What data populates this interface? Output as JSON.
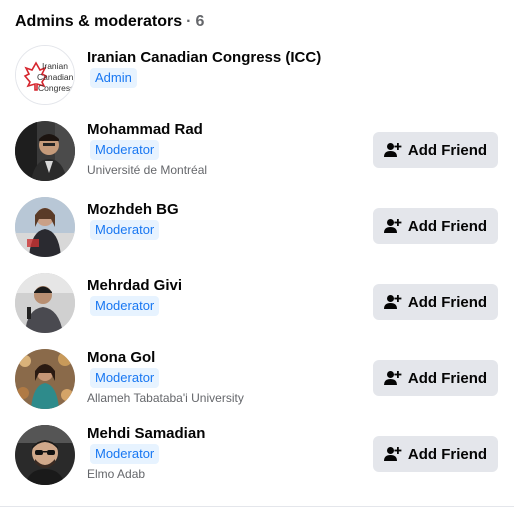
{
  "header": {
    "title": "Admins & moderators",
    "separator": "·",
    "count": "6"
  },
  "members": [
    {
      "name": "Iranian Canadian Congress (ICC)",
      "role": "Admin",
      "subtitle": "",
      "logo_text": [
        "Iranian",
        "Canadian",
        "Congress"
      ]
    },
    {
      "name": "Mohammad Rad",
      "role": "Moderator",
      "subtitle": "Université de Montréal",
      "button": "Add Friend"
    },
    {
      "name": "Mozhdeh BG",
      "role": "Moderator",
      "subtitle": "",
      "button": "Add Friend"
    },
    {
      "name": "Mehrdad Givi",
      "role": "Moderator",
      "subtitle": "",
      "button": "Add Friend"
    },
    {
      "name": "Mona Gol",
      "role": "Moderator",
      "subtitle": "Allameh Tabataba'i University",
      "button": "Add Friend"
    },
    {
      "name": "Mehdi Samadian",
      "role": "Moderator",
      "subtitle": "Elmo Adab",
      "button": "Add Friend"
    }
  ],
  "colors": {
    "badge_text": "#1877f2",
    "badge_bg": "#e7f3ff",
    "button_bg": "#e4e6eb",
    "secondary_text": "#65676b",
    "logo_red": "#d6262e"
  },
  "icons": {
    "add_friend": "person-plus-icon"
  }
}
